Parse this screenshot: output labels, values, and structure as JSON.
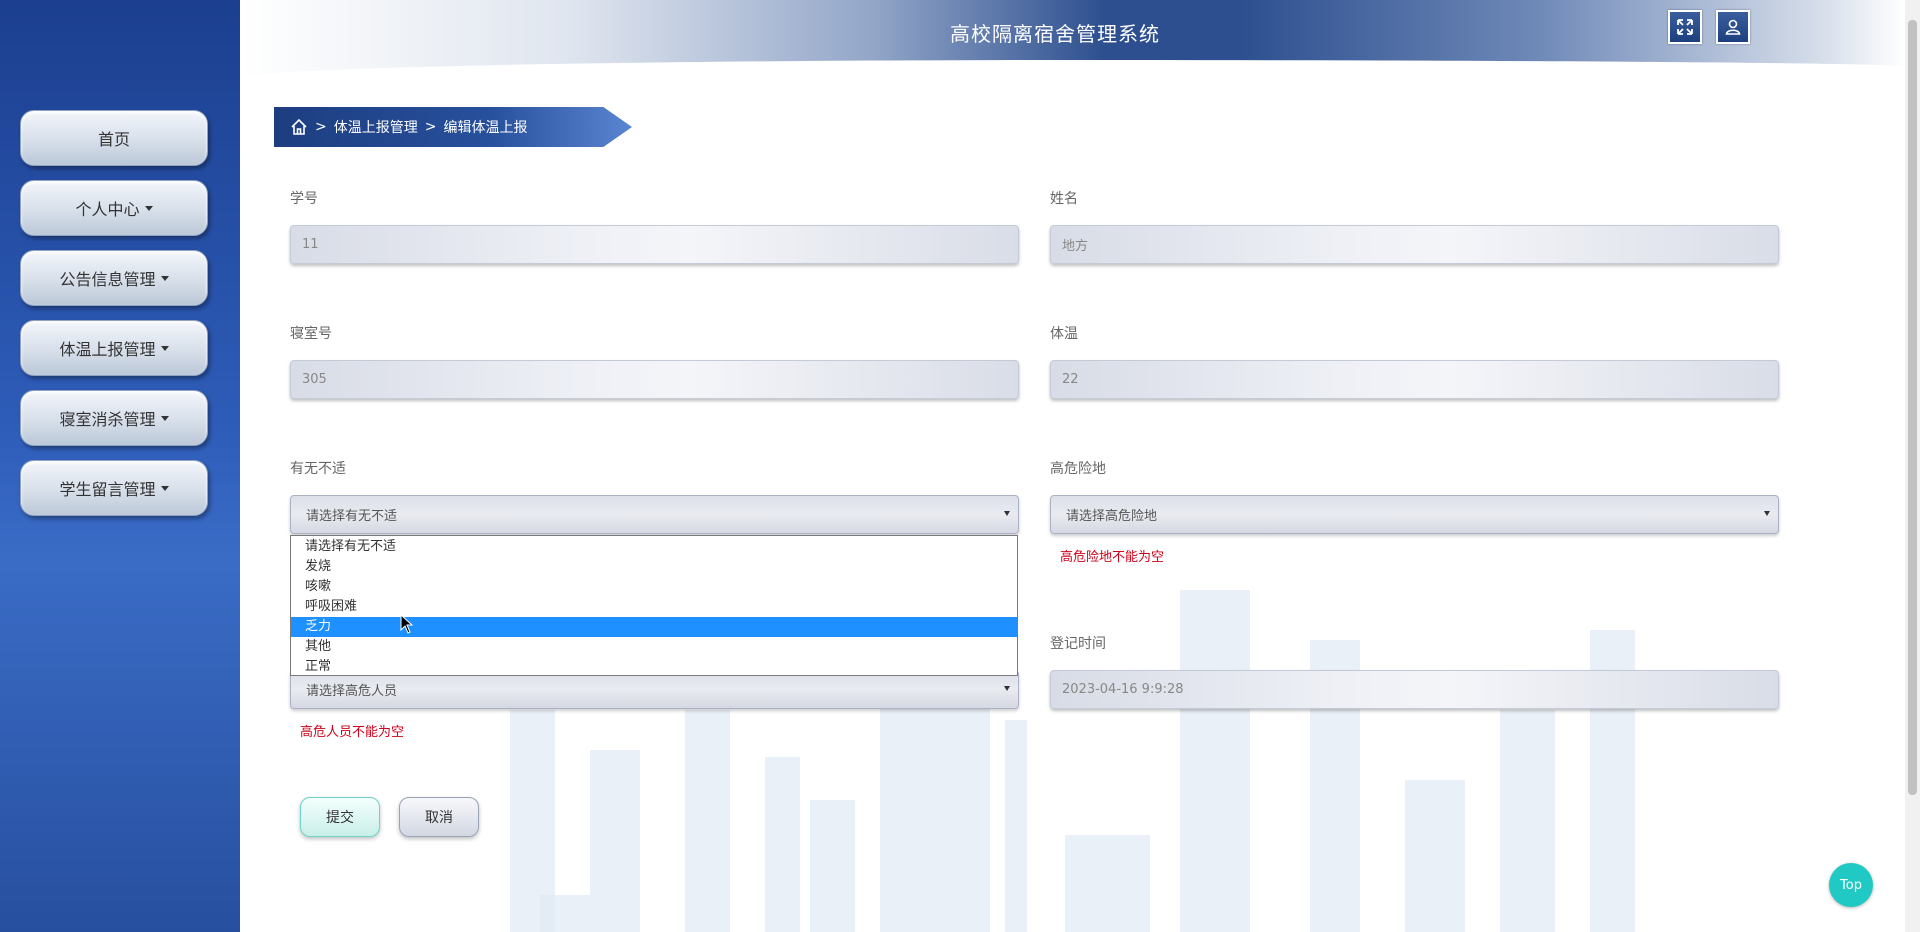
{
  "header": {
    "title": "高校隔离宿舍管理系统"
  },
  "sidebar": {
    "items": [
      {
        "label": "首页",
        "has_caret": false
      },
      {
        "label": "个人中心",
        "has_caret": true
      },
      {
        "label": "公告信息管理",
        "has_caret": true
      },
      {
        "label": "体温上报管理",
        "has_caret": true
      },
      {
        "label": "寝室消杀管理",
        "has_caret": true
      },
      {
        "label": "学生留言管理",
        "has_caret": true
      }
    ]
  },
  "breadcrumb": {
    "level1": "体温上报管理",
    "level2": "编辑体温上报",
    "separator": ">"
  },
  "form": {
    "student_id": {
      "label": "学号",
      "value": "11"
    },
    "name": {
      "label": "姓名",
      "value": "地方"
    },
    "dorm": {
      "label": "寝室号",
      "value": "305"
    },
    "temperature": {
      "label": "体温",
      "value": "22"
    },
    "discomfort": {
      "label": "有无不适",
      "placeholder": "请选择有无不适"
    },
    "risk_area": {
      "label": "高危险地",
      "placeholder": "请选择高危险地",
      "error": "高危险地不能为空"
    },
    "risk_person": {
      "placeholder": "请选择高危人员",
      "error": "高危人员不能为空"
    },
    "register_time": {
      "label": "登记时间",
      "value": "2023-04-16 9:9:28"
    }
  },
  "dropdown": {
    "options": [
      "请选择有无不适",
      "发烧",
      "咳嗽",
      "呼吸困难",
      "乏力",
      "其他",
      "正常"
    ],
    "highlighted": "乏力"
  },
  "buttons": {
    "submit": "提交",
    "cancel": "取消",
    "top": "Top"
  },
  "colors": {
    "sidebar": "#2d5cb8",
    "accent": "#20c9c3",
    "error": "#d0021b",
    "highlight": "#1e90ff"
  }
}
